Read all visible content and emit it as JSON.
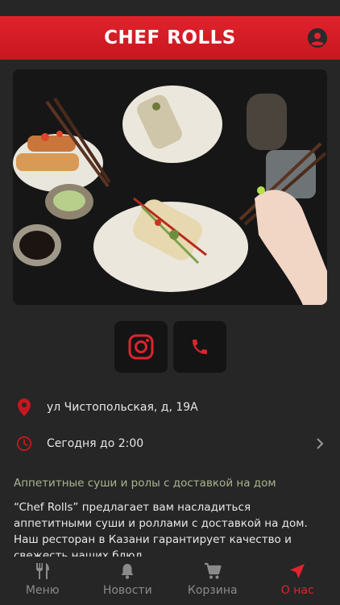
{
  "app": {
    "brand": "Chef Rolls",
    "brand_display": "CHEF ROLLS"
  },
  "colors": {
    "brand_red": "#e0232d",
    "background": "#262626",
    "accent_green": "#a8b58f",
    "nav_inactive": "#8a8a8a"
  },
  "header": {
    "profile_icon": "account-icon"
  },
  "hero": {
    "alt": "sushi rolls on plates"
  },
  "social": {
    "instagram_icon": "instagram-icon",
    "phone_icon": "phone-icon"
  },
  "info": {
    "address": "ул Чистопольская, д, 19А",
    "hours": "Сегодня до 2:00"
  },
  "about": {
    "title": "Аппетитные суши и ролы с доставкой на дом",
    "text": "“Chef Rolls” предлагает вам насладиться аппетитными суши и роллами с доставкой на дом. Наш ресторан в Казани гарантирует качество и свежесть наших блюд."
  },
  "nav": {
    "items": [
      {
        "label": "Меню",
        "icon": "fork-knife-icon"
      },
      {
        "label": "Новости",
        "icon": "bell-icon"
      },
      {
        "label": "Корзина",
        "icon": "cart-icon"
      },
      {
        "label": "О нас",
        "icon": "navigation-arrow-icon"
      }
    ],
    "active": "О нас"
  }
}
